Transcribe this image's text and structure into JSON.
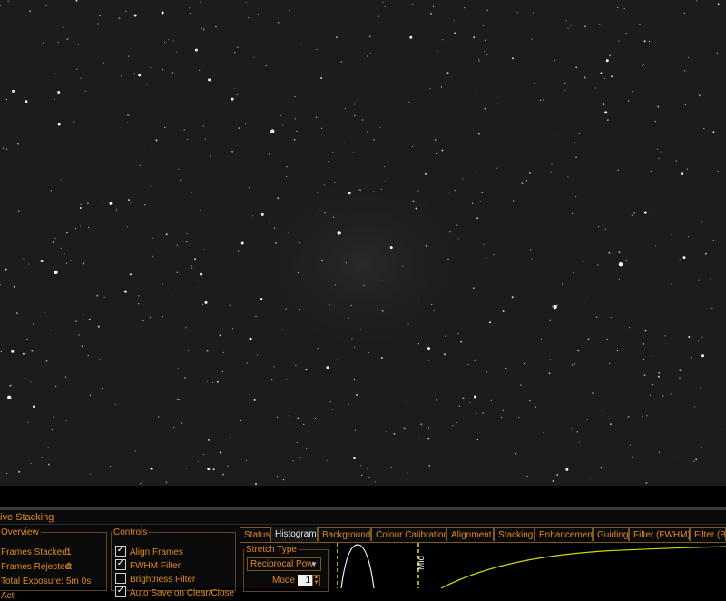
{
  "panel": {
    "title": "ive Stacking",
    "overview": {
      "legend": "Overview",
      "frames_stacked_label": "Frames Stacked:",
      "frames_stacked_value": "1",
      "frames_rejected_label": "Frames Rejected:",
      "frames_rejected_value": "0",
      "total_exposure_label": "Total Exposure:",
      "total_exposure_value": "5m 0s",
      "cut_off_legend": "Act"
    },
    "controls": {
      "legend": "Controls",
      "items": [
        {
          "label": "Align Frames",
          "checked": true
        },
        {
          "label": "FWHM Filter",
          "checked": true
        },
        {
          "label": "Brightness Filter",
          "checked": false
        },
        {
          "label": "Auto Save on Clear/Close",
          "checked": true
        }
      ]
    },
    "tabs": [
      "Status",
      "Histogram",
      "Background",
      "Colour Calibration",
      "Alignment",
      "Stacking",
      "Enhancement",
      "Guiding",
      "Filter (FWHM)",
      "Filter (Bri"
    ],
    "active_tab": "Histogram",
    "histogram": {
      "stretch_legend": "Stretch Type",
      "stretch_value": "Reciprocal Pow",
      "mode_label": "Mode",
      "mode_value": "1",
      "marker_label": "Mid"
    }
  },
  "colors": {
    "accent": "#e08a1e",
    "background": "#0a0a0a",
    "image_bg": "#1c1c1c",
    "curve": "#d8d800",
    "marker": "#e8e800"
  },
  "icons": {
    "checkbox": "checkmark-icon",
    "dropdown": "chevron-down-icon",
    "spin": "spin-arrows-icon"
  }
}
